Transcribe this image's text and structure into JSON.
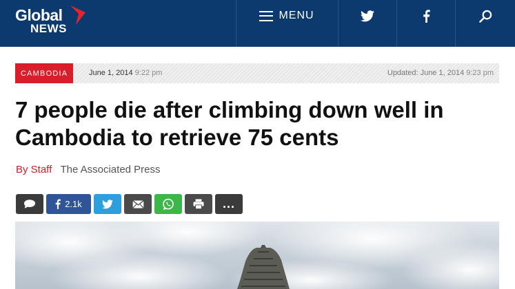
{
  "header": {
    "logo": {
      "line1": "Global",
      "line2": "NEWS"
    },
    "menu_label": "MENU",
    "icons": [
      "hamburger-icon",
      "twitter-icon",
      "facebook-icon",
      "search-icon"
    ]
  },
  "article": {
    "category": "CAMBODIA",
    "published_date": "June 1, 2014",
    "published_time": "9:22 pm",
    "updated_label": "Updated: June 1, 2014",
    "updated_time": "9:23 pm",
    "headline": "7 people die after climbing down well in Cambodia to retrieve 75 cents",
    "byline_author": "By Staff",
    "byline_org": "The Associated Press"
  },
  "share": {
    "facebook_count": "2.1k",
    "more_label": "..."
  },
  "colors": {
    "header_bg": "#0d3a6e",
    "accent_red": "#d81e2a",
    "facebook": "#2f5598",
    "twitter": "#2c9fdc",
    "whatsapp": "#3cb84a"
  }
}
